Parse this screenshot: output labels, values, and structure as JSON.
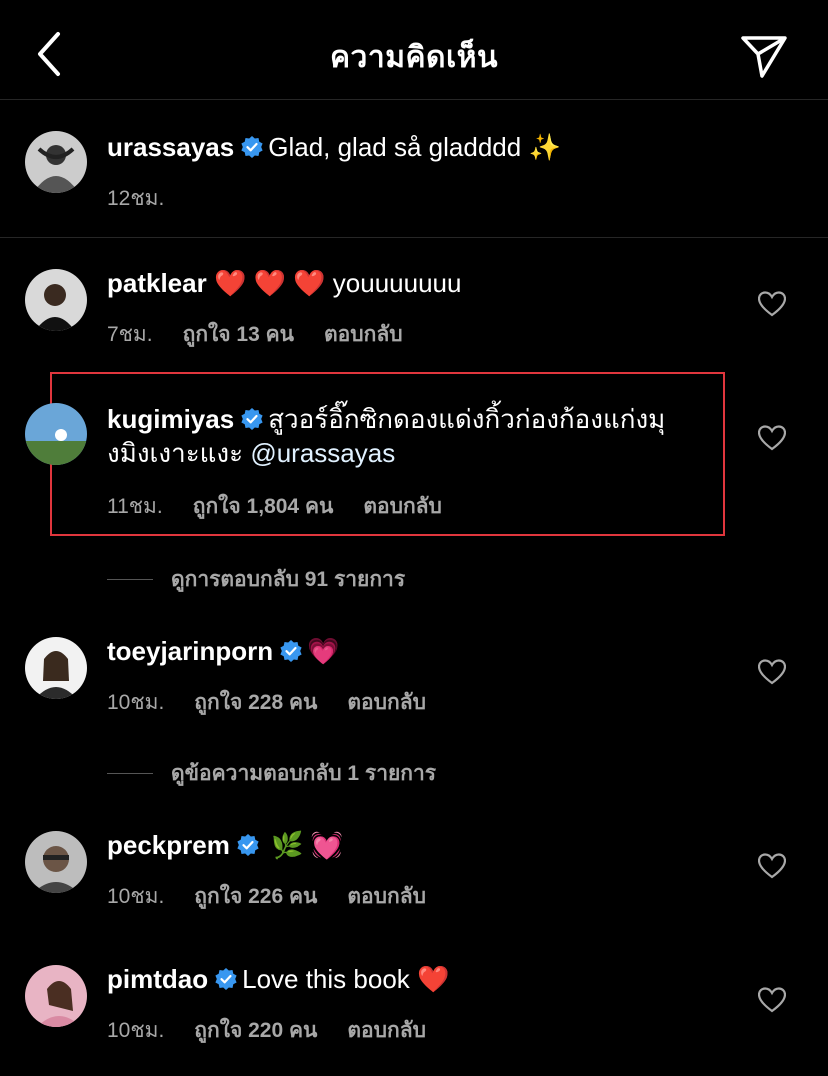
{
  "header": {
    "title": "ความคิดเห็น"
  },
  "caption": {
    "username": "urassayas",
    "text": "Glad, glad så gladddd",
    "emoji": "✨",
    "time": "12ชม."
  },
  "comments": [
    {
      "username": "patklear",
      "emoji_before": "❤️ ❤️ ❤️",
      "text": "youuuuuuu",
      "time": "7ชม.",
      "likes": "ถูกใจ 13 คน",
      "reply": "ตอบกลับ"
    },
    {
      "username": "kugimiyas",
      "text": "สูวอร์อิ๊กซิกดองแด่งกิ้วก่องก้องแก่งมุงมิงเงาะแงะ",
      "mention": "@urassayas",
      "time": "11ชม.",
      "likes": "ถูกใจ 1,804 คน",
      "reply": "ตอบกลับ",
      "view_replies": "ดูการตอบกลับ 91 รายการ"
    },
    {
      "username": "toeyjarinporn",
      "emoji": "💗",
      "time": "10ชม.",
      "likes": "ถูกใจ 228 คน",
      "reply": "ตอบกลับ",
      "view_replies": "ดูข้อความตอบกลับ 1 รายการ"
    },
    {
      "username": "peckprem",
      "emoji": "🌿 💓",
      "time": "10ชม.",
      "likes": "ถูกใจ 226 คน",
      "reply": "ตอบกลับ"
    },
    {
      "username": "pimtdao",
      "text": "Love this book",
      "emoji": "❤️",
      "time": "10ชม.",
      "likes": "ถูกใจ 220 คน",
      "reply": "ตอบกลับ"
    }
  ],
  "colors": {
    "verified": "#3897f0",
    "highlight_box": "#e0363d",
    "secondary_text": "#a8a8a8"
  },
  "icons": {
    "back": "chevron-left-icon",
    "send": "paper-plane-icon",
    "like": "heart-outline-icon",
    "verified": "verified-badge-icon"
  }
}
